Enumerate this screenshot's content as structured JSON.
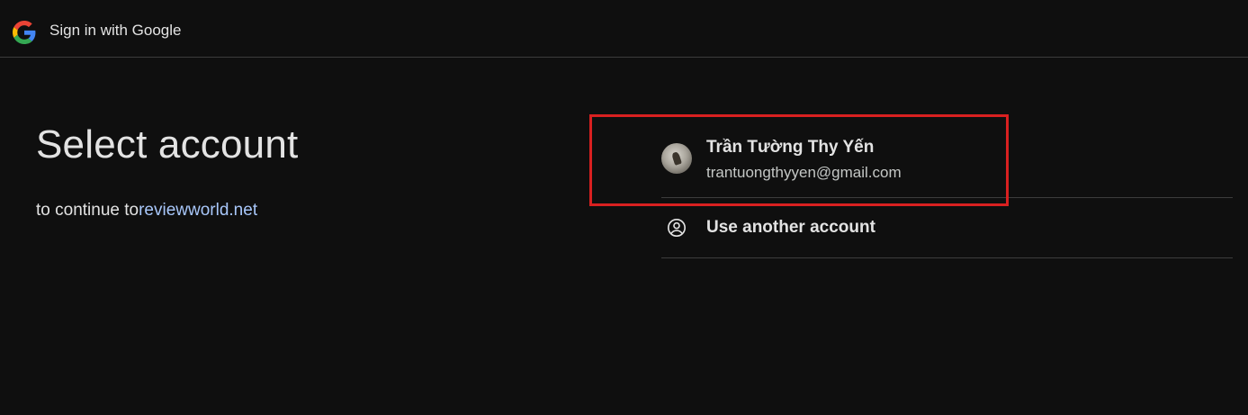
{
  "header": {
    "logo_icon": "google-g-icon",
    "title": "Sign in with Google"
  },
  "main": {
    "title": "Select account",
    "subtitle_prefix": "to continue to",
    "subtitle_link": "reviewworld.net"
  },
  "accounts": [
    {
      "name": "Trần Tường Thy Yến",
      "email": "trantuongthyyen@gmail.com",
      "avatar_icon": "avatar"
    }
  ],
  "another_account": {
    "icon": "account-circle-icon",
    "label": "Use another account"
  },
  "colors": {
    "background": "#0f0f0f",
    "text": "#e3e3e3",
    "link": "#a8c7fa",
    "divider": "#3c3c3c",
    "highlight": "#d92020"
  }
}
